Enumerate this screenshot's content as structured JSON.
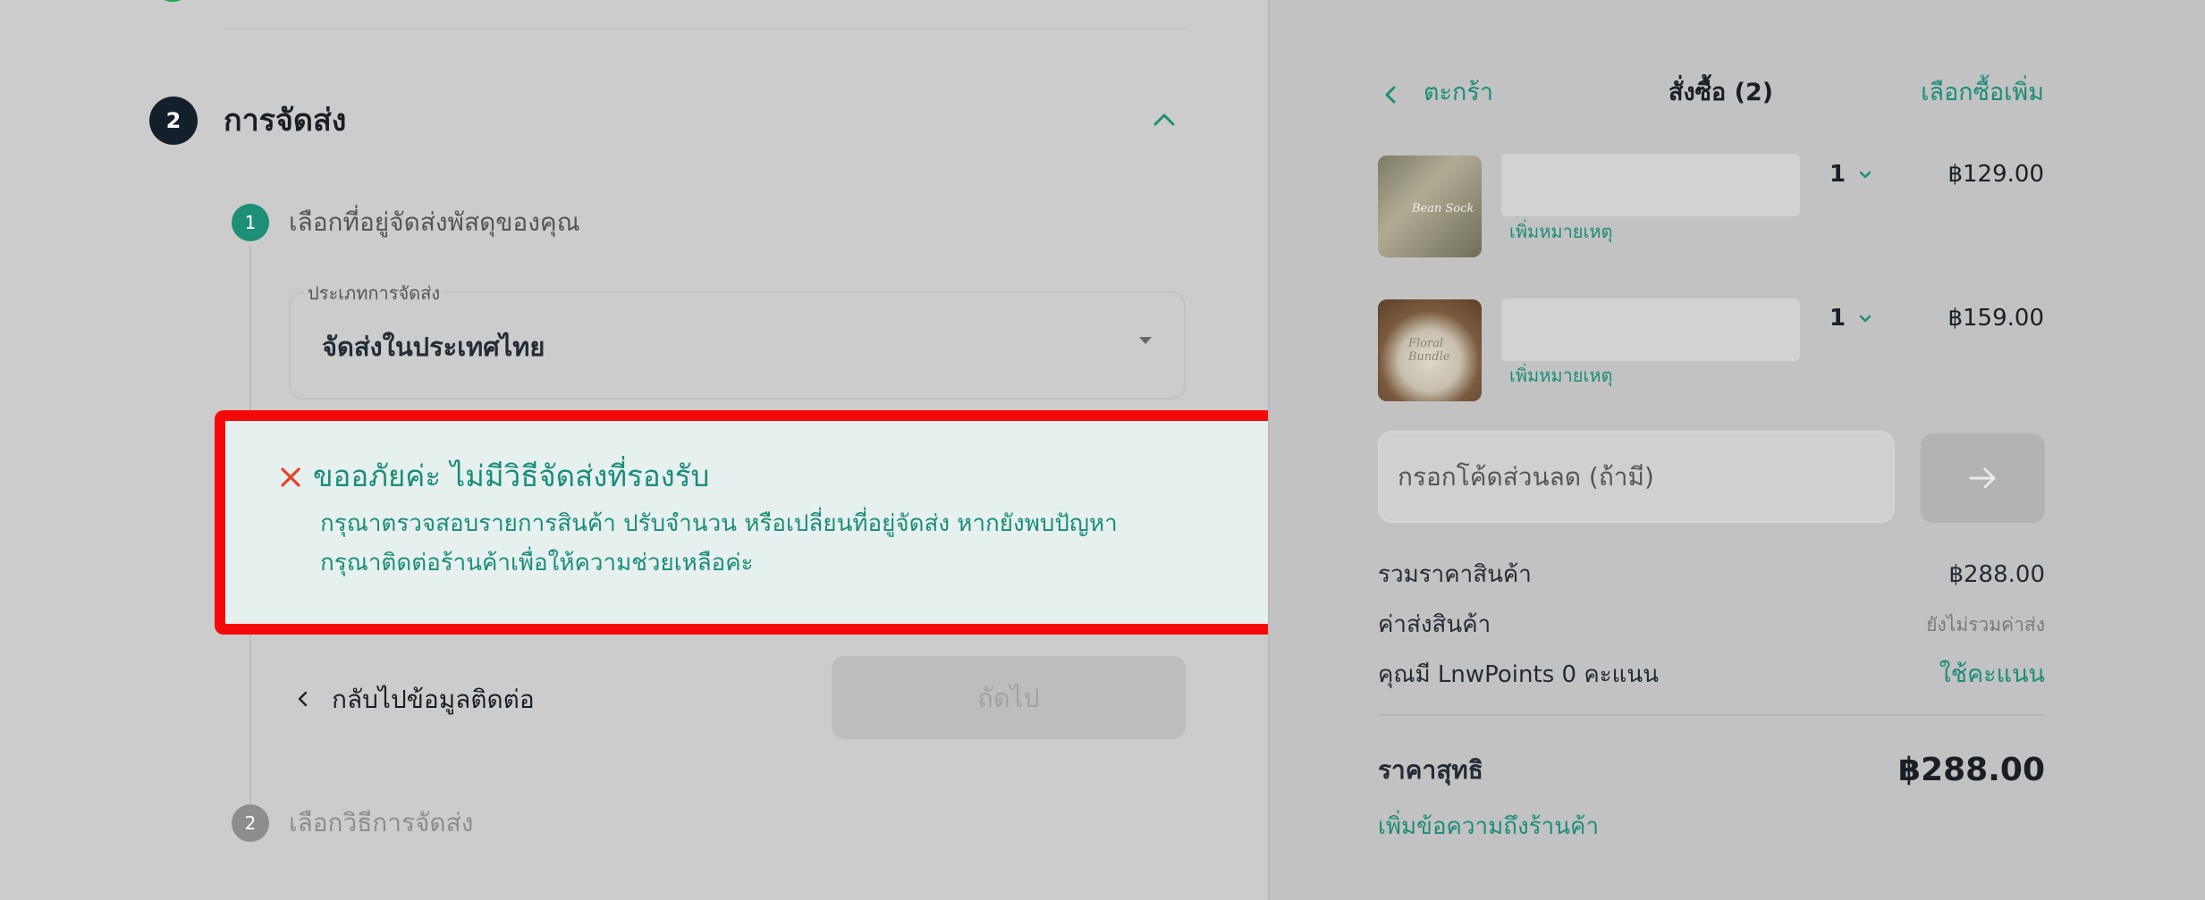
{
  "checkout": {
    "section_number": "2",
    "section_title": "การจัดส่ง",
    "substep1": {
      "number": "1",
      "label": "เลือกที่อยู่จัดส่งพัสดุของคุณ"
    },
    "shipping_type": {
      "label": "ประเภทการจัดส่ง",
      "value": "จัดส่งในประเทศไทย"
    },
    "alert": {
      "title": "ขออภัยค่ะ ไม่มีวิธีจัดส่งที่รองรับ",
      "line1": "กรุณาตรวจสอบรายการสินค้า ปรับจำนวน หรือเปลี่ยนที่อยู่จัดส่ง หากยังพบปัญหา",
      "line2": "กรุณาติดต่อร้านค้าเพื่อให้ความช่วยเหลือค่ะ",
      "outline_color": "#f40a0a",
      "text_color": "#1b8d78"
    },
    "back_label": "กลับไปข้อมูลติดต่อ",
    "next_label": "ถัดไป",
    "substep2": {
      "number": "2",
      "label": "เลือกวิธีการจัดส่ง"
    }
  },
  "cart": {
    "back_label": "ตะกร้า",
    "title": "สั่งซื้อ (2)",
    "more_label": "เลือกซื้อเพิ่ม",
    "items": [
      {
        "thumb_text": "Bean Sock",
        "qty": "1",
        "price": "฿129.00",
        "note_label": "เพิ่มหมายเหตุ"
      },
      {
        "thumb_text": "Floral Bundle",
        "qty": "1",
        "price": "฿159.00",
        "note_label": "เพิ่มหมายเหตุ"
      }
    ],
    "discount_placeholder": "กรอกโค้ดส่วนลด (ถ้ามี)",
    "summary": {
      "subtotal_label": "รวมราคาสินค้า",
      "subtotal_value": "฿288.00",
      "shipping_label": "ค่าส่งสินค้า",
      "shipping_value": "ยังไม่รวมค่าส่ง",
      "points_label": "คุณมี LnwPoints 0 คะแนน",
      "points_action": "ใช้คะแนน",
      "net_label": "ราคาสุทธิ",
      "net_value": "฿288.00"
    },
    "message_link": "เพิ่มข้อความถึงร้านค้า"
  },
  "colors": {
    "accent": "#1b8d78",
    "badge_dark": "#13202c",
    "background": "#cccccc"
  }
}
